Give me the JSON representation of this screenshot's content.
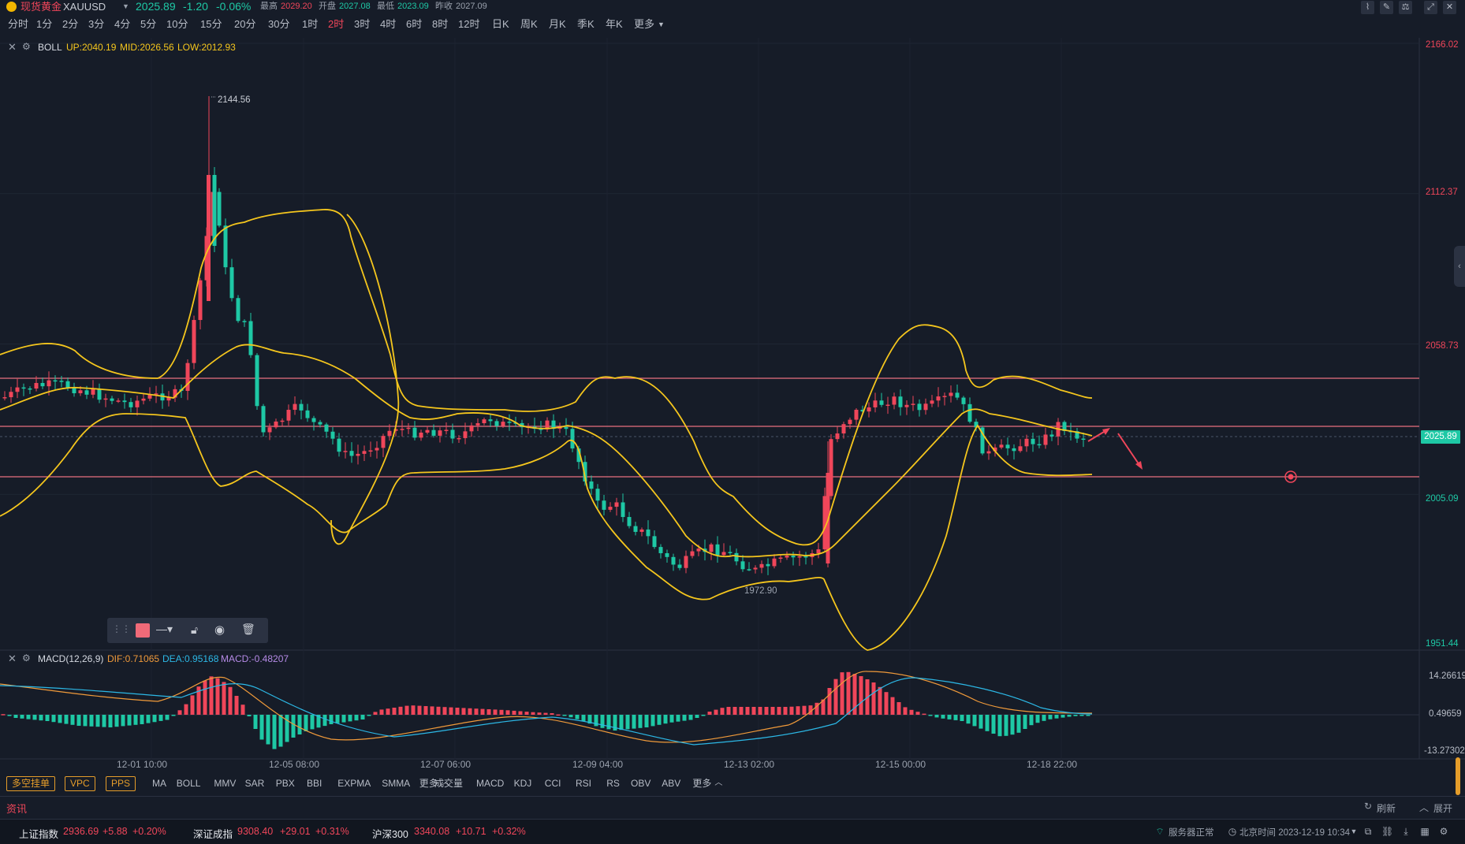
{
  "header": {
    "instrument_name": "现货黄金",
    "symbol": "XAUUSD",
    "price": "2025.89",
    "change": "-1.20",
    "change_pct": "-0.06%",
    "high_label": "最高",
    "high_value": "2029.20",
    "open_label": "开盘",
    "open_value": "2027.08",
    "low_label": "最低",
    "low_value": "2023.09",
    "prev_close_label": "昨收",
    "prev_close_value": "2027.09",
    "colors": {
      "up": "#f0465a",
      "down": "#1ec8a5",
      "gold": "#f2b600"
    }
  },
  "periods": {
    "items": [
      "分时",
      "1分",
      "2分",
      "3分",
      "4分",
      "5分",
      "10分",
      "15分",
      "20分",
      "30分",
      "1时",
      "2时",
      "3时",
      "4时",
      "6时",
      "8时",
      "12时",
      "日K",
      "周K",
      "月K",
      "季K",
      "年K",
      "更多"
    ],
    "active": "2时"
  },
  "boll": {
    "name": "BOLL",
    "up": "UP:2040.19",
    "mid": "MID:2026.56",
    "low": "LOW:2012.93"
  },
  "price_axis": [
    "2166.02",
    "2112.37",
    "2058.73",
    "2005.09",
    "1951.44"
  ],
  "current_price_tag": "2025.89",
  "annotations": {
    "high_marker": "2144.56",
    "low_marker": "1972.90"
  },
  "macd": {
    "name": "MACD(12,26,9)",
    "dif": "DIF:0.71065",
    "dea": "DEA:0.95168",
    "macd": "MACD:-0.48207",
    "axis": [
      "14.26619",
      "0.49659",
      "-13.27302"
    ]
  },
  "time_axis": [
    "12-01 10:00",
    "12-05 08:00",
    "12-07 06:00",
    "12-09 04:00",
    "12-13 02:00",
    "12-15 00:00",
    "12-18 22:00"
  ],
  "indicator_bar": {
    "tags": [
      "多空挂单",
      "VPC",
      "PPS"
    ],
    "main_indicators": [
      "MA",
      "BOLL",
      "MMV",
      "SAR",
      "PBX",
      "BBI",
      "EXPMA",
      "SMMA",
      "更多"
    ],
    "sub_indicators": [
      "成交量",
      "MACD",
      "KDJ",
      "CCI",
      "RSI",
      "RS",
      "OBV",
      "ABV",
      "更多"
    ]
  },
  "news_bar": {
    "title": "资讯",
    "refresh": "刷新",
    "expand": "展开"
  },
  "status_bar": {
    "indices": [
      {
        "name": "上证指数",
        "value": "2936.69",
        "change": "+5.88",
        "pct": "+0.20%"
      },
      {
        "name": "深证成指",
        "value": "9308.40",
        "change": "+29.01",
        "pct": "+0.31%"
      },
      {
        "name": "沪深300",
        "value": "3340.08",
        "change": "+10.71",
        "pct": "+0.32%"
      }
    ],
    "server_status": "服务器正常",
    "beijing_time": "北京时间 2023-12-19 10:34"
  }
}
